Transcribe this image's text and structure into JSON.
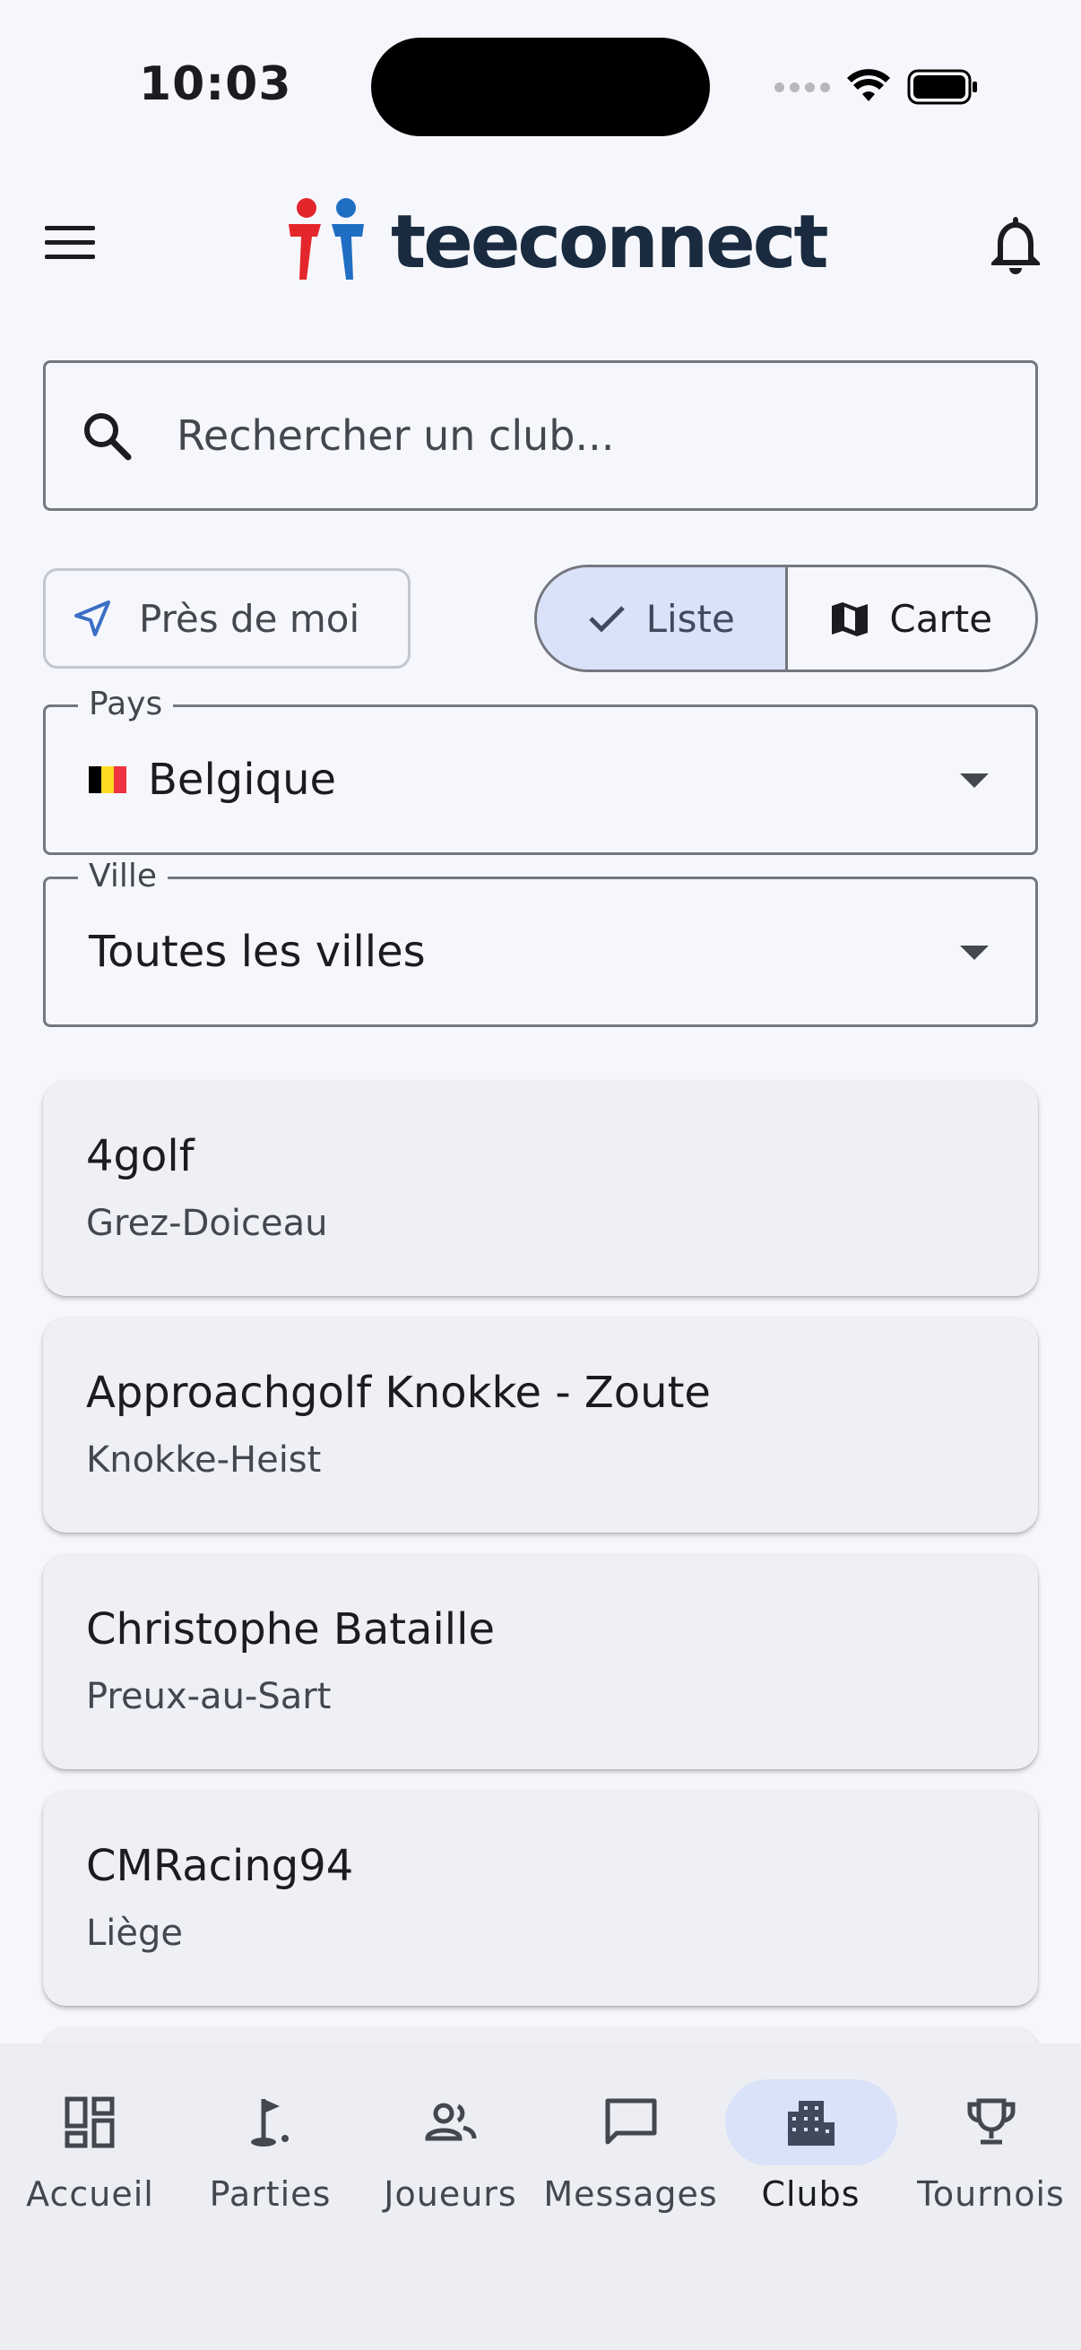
{
  "status_bar": {
    "time": "10:03"
  },
  "app_bar": {
    "logo_text": "teeconnect"
  },
  "search": {
    "placeholder": "Rechercher un club..."
  },
  "filters": {
    "near_me_label": "Près de moi",
    "view_toggle": {
      "list_label": "Liste",
      "map_label": "Carte",
      "selected": "Liste"
    }
  },
  "country_select": {
    "label": "Pays",
    "value": "Belgique",
    "flag_colors": [
      "#000000",
      "#FDDA24",
      "#EF3340"
    ]
  },
  "city_select": {
    "label": "Ville",
    "value": "Toutes les villes"
  },
  "clubs": [
    {
      "name": "4golf",
      "city": "Grez-Doiceau"
    },
    {
      "name": "Approachgolf Knokke - Zoute",
      "city": "Knokke-Heist"
    },
    {
      "name": "Christophe Bataille",
      "city": "Preux-au-Sart"
    },
    {
      "name": "CMRacing94",
      "city": "Liège"
    }
  ],
  "bottom_nav": {
    "active": "Clubs",
    "items": [
      {
        "label": "Accueil",
        "icon": "dashboard-icon"
      },
      {
        "label": "Parties",
        "icon": "golf-flag-icon"
      },
      {
        "label": "Joueurs",
        "icon": "people-icon"
      },
      {
        "label": "Messages",
        "icon": "chat-icon"
      },
      {
        "label": "Clubs",
        "icon": "building-icon"
      },
      {
        "label": "Tournois",
        "icon": "trophy-icon"
      }
    ]
  },
  "colors": {
    "accent_container": "#dae2f9",
    "logo_red": "#e3262b",
    "logo_blue": "#1f6ec3",
    "logo_text": "#1a2b3f"
  }
}
